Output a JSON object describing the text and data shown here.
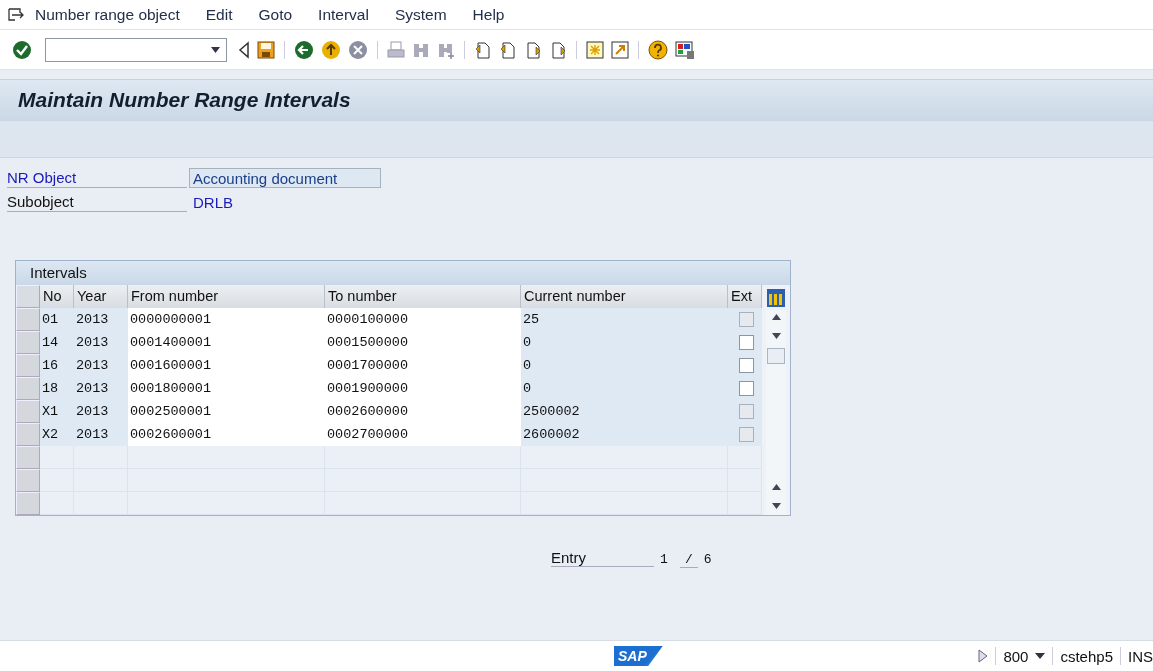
{
  "menu_bar": {
    "items": [
      "Number range object",
      "Edit",
      "Goto",
      "Interval",
      "System",
      "Help"
    ]
  },
  "title": "Maintain Number Range Intervals",
  "header_fields": [
    {
      "label": "NR Object",
      "value": "Accounting document",
      "kind": "field"
    },
    {
      "label": "Subobject",
      "value": "DRLB",
      "kind": "text"
    }
  ],
  "intervals": {
    "title": "Intervals",
    "columns": [
      "No",
      "Year",
      "From number",
      "To number",
      "Current number",
      "Ext"
    ],
    "rows": [
      {
        "no": "01",
        "year": "2013",
        "from": "0000000001",
        "to": "0000100000",
        "current": "25",
        "ext_checked": false,
        "ext_disabled": true
      },
      {
        "no": "14",
        "year": "2013",
        "from": "0001400001",
        "to": "0001500000",
        "current": "0",
        "ext_checked": false,
        "ext_disabled": false
      },
      {
        "no": "16",
        "year": "2013",
        "from": "0001600001",
        "to": "0001700000",
        "current": "0",
        "ext_checked": false,
        "ext_disabled": false
      },
      {
        "no": "18",
        "year": "2013",
        "from": "0001800001",
        "to": "0001900000",
        "current": "0",
        "ext_checked": false,
        "ext_disabled": false
      },
      {
        "no": "X1",
        "year": "2013",
        "from": "0002500001",
        "to": "0002600000",
        "current": "2500002",
        "ext_checked": false,
        "ext_disabled": true
      },
      {
        "no": "X2",
        "year": "2013",
        "from": "0002600001",
        "to": "0002700000",
        "current": "2600002",
        "ext_checked": false,
        "ext_disabled": true
      }
    ]
  },
  "entry": {
    "label": "Entry",
    "current": "1",
    "separator": "/",
    "total": "6"
  },
  "status_bar": {
    "logo": "SAP",
    "client": "800",
    "system": "cstehp5",
    "mode": "INS"
  }
}
